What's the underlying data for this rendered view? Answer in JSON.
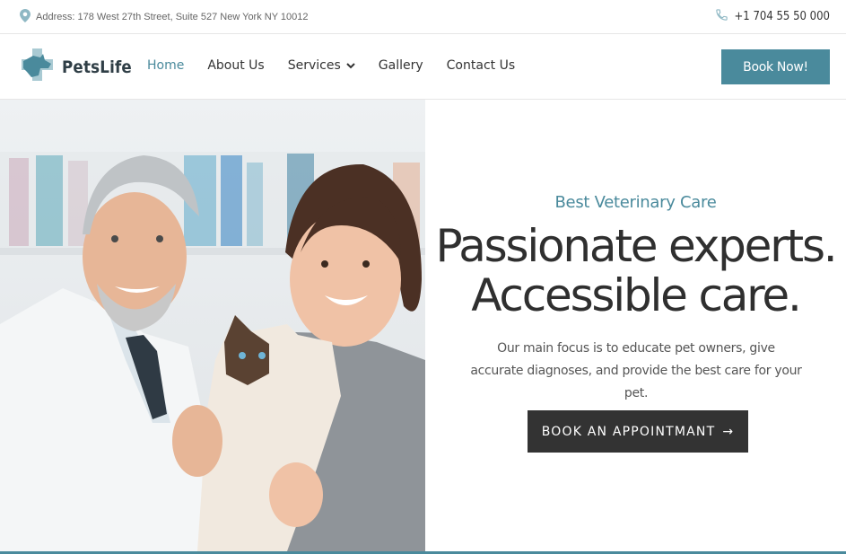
{
  "topbar": {
    "address": "Address: 178 West 27th Street, Suite 527 New York NY 10012",
    "phone": "+1 704 55 50 000",
    "icons": {
      "address": "map-pin-icon",
      "phone": "phone-icon"
    }
  },
  "nav": {
    "logo_text": "PetsLife",
    "items": [
      {
        "label": "Home",
        "active": true
      },
      {
        "label": "About Us"
      },
      {
        "label": "Services",
        "dropdown": true
      },
      {
        "label": "Gallery"
      },
      {
        "label": "Contact Us"
      }
    ],
    "book_now": "Book Now!"
  },
  "hero": {
    "eyebrow": "Best Veterinary Care",
    "headline_line1": "Passionate experts.",
    "headline_line2": "Accessible care.",
    "description": "Our main focus is to educate pet owners, give accurate diagnoses, and provide the best care for your pet.",
    "cta": "BOOK AN APPOINTMANT",
    "cta_arrow": "→"
  },
  "colors": {
    "accent": "#4a8a9c",
    "dark_button": "#333333",
    "text": "#333333"
  }
}
